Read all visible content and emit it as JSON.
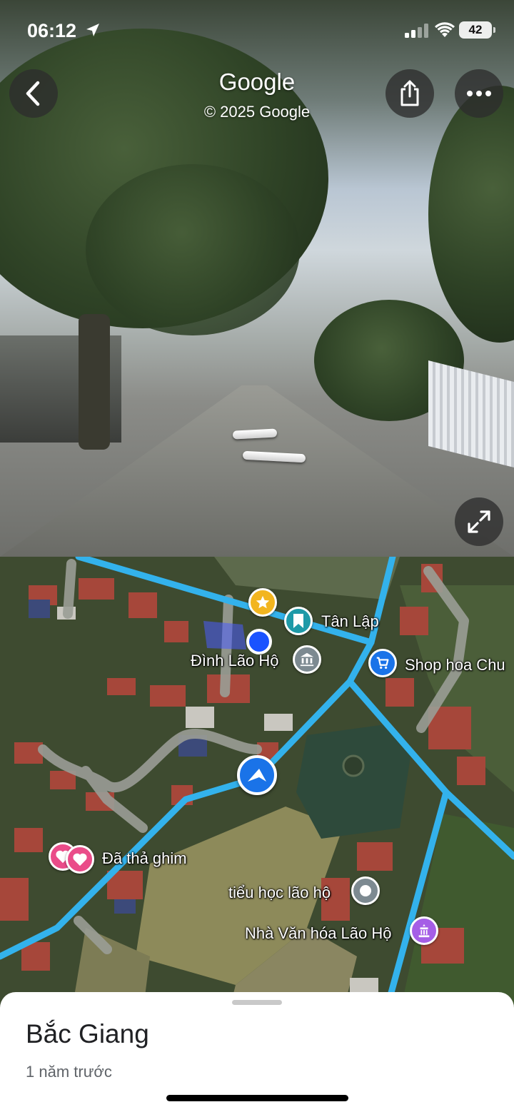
{
  "status_bar": {
    "time": "06:12",
    "battery": "42"
  },
  "street_view": {
    "title": "Google",
    "copyright": "© 2025 Google",
    "buttons": {
      "back": "chevron-left-icon",
      "share": "share-icon",
      "more": "more-horizontal-icon",
      "expand": "expand-icon"
    }
  },
  "map": {
    "labels": {
      "tan_lap": "Tân Lập",
      "dinh_lao_ho": "Đình Lão Hộ",
      "shop_hoa": "Shop hoa Chu",
      "da_tha_ghim": "Đã thả ghim",
      "tieu_hoc": "tiểu học lão hộ",
      "nha_van_hoa": "Nhà Văn hóa Lão Hộ"
    },
    "colors": {
      "street_view_road": "#33b2ec",
      "user_location": "#1a53ff",
      "star_pin": "#f2b51f",
      "saved_pin": "#1e9aa8",
      "shop_pin": "#1a73e8",
      "heart_pin": "#ea4c89",
      "school_pin": "#7d8a91",
      "culture_pin": "#a55ee6"
    }
  },
  "sheet": {
    "title": "Bắc Giang",
    "subtitle": "1 năm trước"
  }
}
